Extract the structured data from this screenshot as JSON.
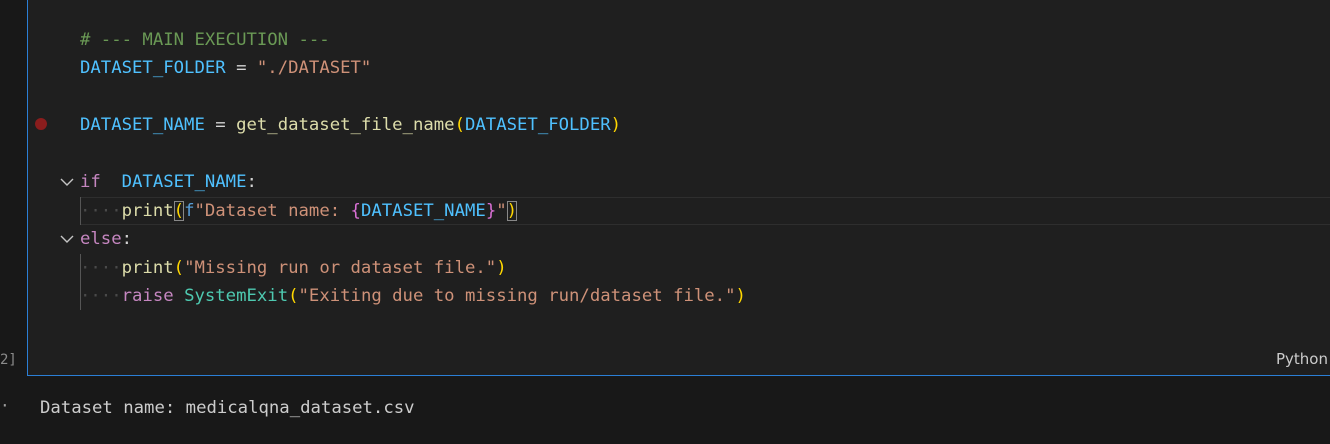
{
  "cell": {
    "index_label": "2]",
    "language": "Python",
    "code": {
      "line1": {
        "comment": "# --- MAIN EXECUTION ---"
      },
      "line2": {
        "var": "DATASET_FOLDER",
        "op": " = ",
        "str": "\"./DATASET\""
      },
      "line4": {
        "var": "DATASET_NAME",
        "op": " = ",
        "fn": "get_dataset_file_name",
        "open": "(",
        "arg": "DATASET_FOLDER",
        "close": ")"
      },
      "line6": {
        "kw": "if",
        "sp": "  ",
        "var": "DATASET_NAME",
        "colon": ":"
      },
      "line7": {
        "fn": "print",
        "open": "(",
        "fpre": "f",
        "str": "\"Dataset name: ",
        "lbrace": "{",
        "var": "DATASET_NAME",
        "rbrace": "}",
        "strend": "\"",
        "close": ")"
      },
      "line8": {
        "kw": "else",
        "colon": ":"
      },
      "line9": {
        "fn": "print",
        "open": "(",
        "str": "\"Missing run or dataset file.\"",
        "close": ")"
      },
      "line10": {
        "kw": "raise",
        "cls": "SystemExit",
        "open": "(",
        "str": "\"Exiting due to missing run/dataset file.\"",
        "close": ")"
      }
    }
  },
  "output": {
    "text": "Dataset name: medicalqna_dataset.csv"
  },
  "icons": {
    "fold": "chevron-down-icon",
    "breakpoint": "breakpoint-icon"
  },
  "colors": {
    "editor_bg": "#1f1f1f",
    "cell_border": "#2b7fd6",
    "breakpoint": "#8a1d1d"
  }
}
